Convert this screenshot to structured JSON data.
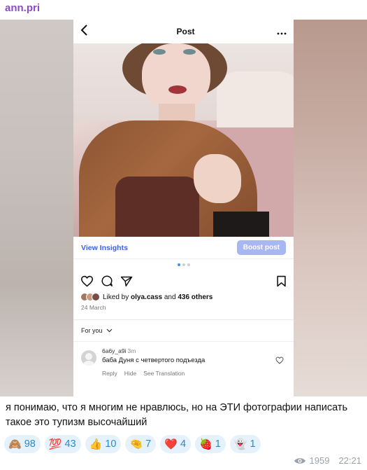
{
  "channel": {
    "name": "ann.pri"
  },
  "post": {
    "header_title": "Post",
    "back_icon": "chevron-left-icon",
    "more_icon": "ellipsis-icon",
    "view_insights": "View Insights",
    "boost_post": "Boost post",
    "liked_by_prefix": "Liked by",
    "liked_by_user": "olya.cass",
    "liked_by_and": "and",
    "liked_by_others": "436 others",
    "date": "24 March",
    "for_you": "For you",
    "carousel": {
      "count": 3,
      "active": 1
    },
    "comment": {
      "username": "6a6y_a9i",
      "time": "3m",
      "text": "баба Дуня с четвертого подъезда",
      "reply": "Reply",
      "hide": "Hide",
      "see_translation": "See Translation"
    },
    "colors": {
      "link": "#3d63d6",
      "boost_bg": "#a8b6f2"
    }
  },
  "message": {
    "caption": "я понимаю, что я многим не нравлюсь, но на ЭТИ фотографии написать такое это тупизм высочайший",
    "reactions": [
      {
        "emoji": "🙈",
        "count": "98"
      },
      {
        "emoji": "💯",
        "count": "43"
      },
      {
        "emoji": "👍",
        "count": "10"
      },
      {
        "emoji": "🤏",
        "count": "7"
      },
      {
        "emoji": "❤️",
        "count": "4"
      },
      {
        "emoji": "🍓",
        "count": "1"
      },
      {
        "emoji": "👻",
        "count": "1"
      }
    ],
    "views": "1959",
    "time": "22:21",
    "colors": {
      "channel_name": "#8b4ec2",
      "reaction_bg": "#e5f1fb",
      "reaction_text": "#2c8ac9"
    }
  }
}
